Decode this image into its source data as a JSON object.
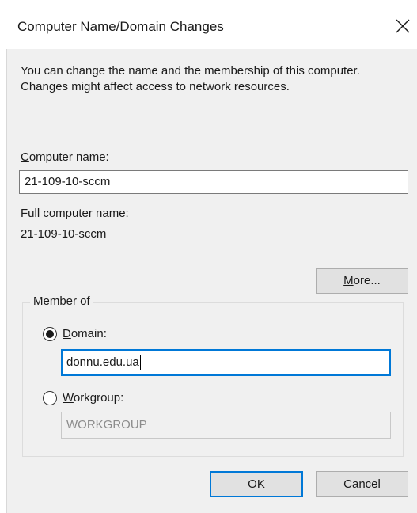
{
  "dialog": {
    "title": "Computer Name/Domain Changes",
    "close_icon": "close-icon",
    "description": "You can change the name and the membership of this computer. Changes might affect access to network resources.",
    "computer_name": {
      "label_accel": "C",
      "label_rest": "omputer name:",
      "value": "21-109-10-sccm"
    },
    "full_computer_name": {
      "label": "Full computer name:",
      "value": "21-109-10-sccm"
    },
    "more_button": {
      "accel": "M",
      "rest": "ore..."
    },
    "member_of": {
      "legend": "Member of",
      "domain": {
        "accel": "D",
        "rest": "omain:",
        "value": "donnu.edu.ua",
        "selected": true
      },
      "workgroup": {
        "accel": "W",
        "rest": "orkgroup:",
        "value": "WORKGROUP",
        "selected": false
      }
    },
    "ok_label": "OK",
    "cancel_label": "Cancel",
    "accent_color": "#0078d7"
  }
}
